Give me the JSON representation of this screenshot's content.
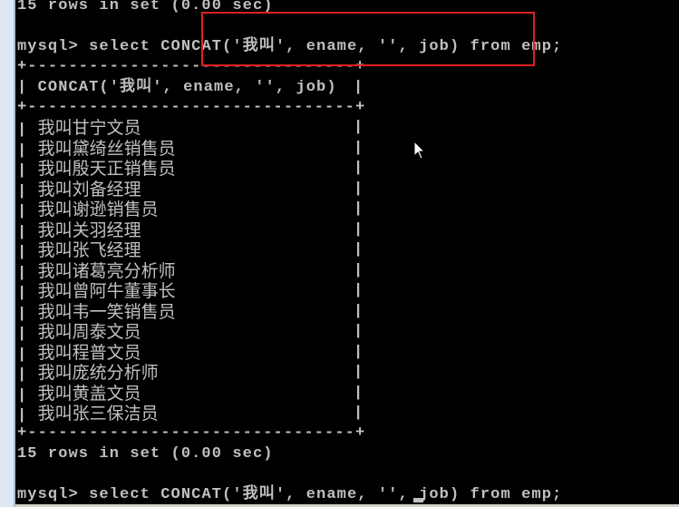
{
  "console": {
    "top_status": "15 rows in set (0.00 sec)",
    "prompt": "mysql>",
    "query": "select CONCAT('我叫', ename, '', job) from emp;",
    "border": "+--------------------------------+",
    "column_header": "CONCAT('我叫', ename, '', job)",
    "rows": [
      "我叫甘宁文员",
      "我叫黛绮丝销售员",
      "我叫殷天正销售员",
      "我叫刘备经理",
      "我叫谢逊销售员",
      "我叫关羽经理",
      "我叫张飞经理",
      "我叫诸葛亮分析师",
      "我叫曾阿牛董事长",
      "我叫韦一笑销售员",
      "我叫周泰文员",
      "我叫程普文员",
      "我叫庞统分析师",
      "我叫黄盖文员",
      "我叫张三保洁员"
    ],
    "bottom_status": "15 rows in set (0.00 sec)",
    "current_prompt": "mysql>",
    "current_input": "select CONCAT('我叫', ename, '', job) from emp;"
  },
  "colors": {
    "text": "#c0c0c0",
    "background": "#000000",
    "highlight": "#e02020"
  }
}
